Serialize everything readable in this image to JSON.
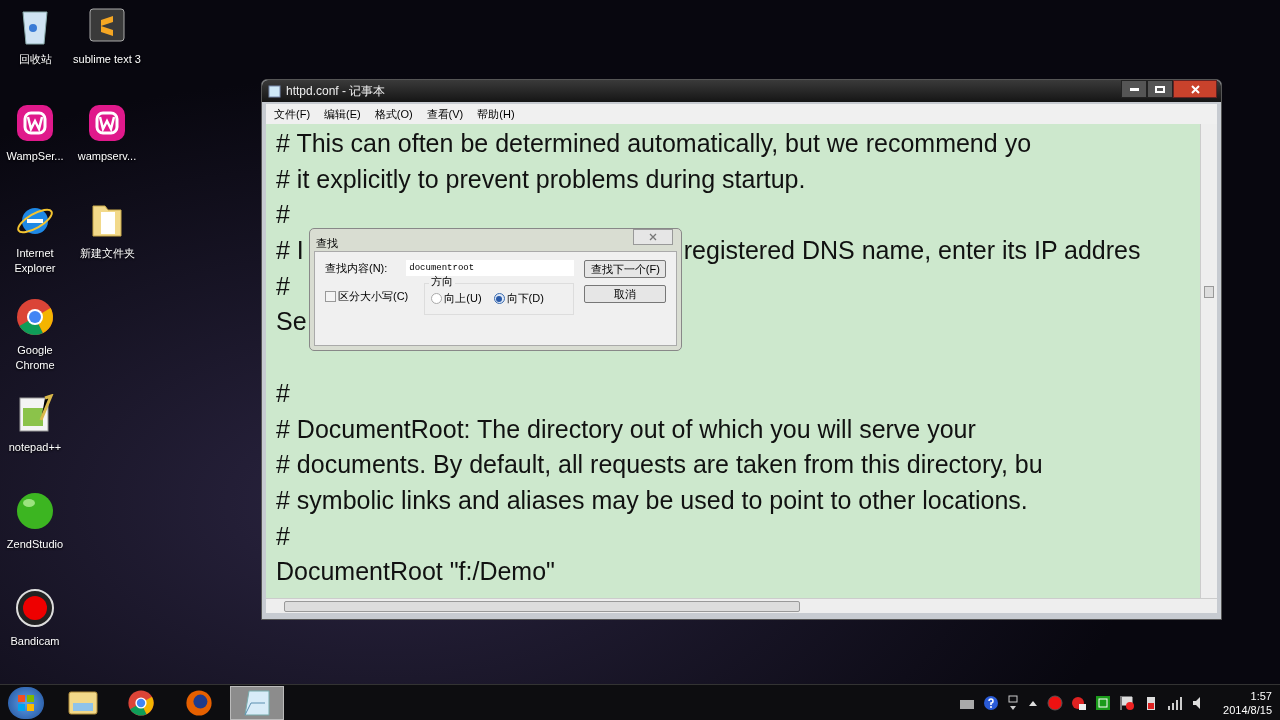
{
  "desktop_columns": [
    [
      {
        "label": "回收站",
        "kind": "recycle"
      },
      {
        "label": "WampSer...",
        "kind": "wamp"
      },
      {
        "label": "Internet Explorer",
        "kind": "ie"
      },
      {
        "label": "Google Chrome",
        "kind": "chrome"
      },
      {
        "label": "notepad++",
        "kind": "notepadpp"
      },
      {
        "label": "ZendStudio",
        "kind": "zend"
      },
      {
        "label": "Bandicam",
        "kind": "bandicam"
      }
    ],
    [
      {
        "label": "sublime text 3",
        "kind": "sublime"
      },
      {
        "label": "wampserv...",
        "kind": "wamp"
      },
      {
        "label": "新建文件夹",
        "kind": "folder"
      }
    ]
  ],
  "window": {
    "title": "httpd.conf - 记事本",
    "menu": [
      "文件(F)",
      "编辑(E)",
      "格式(O)",
      "查看(V)",
      "帮助(H)"
    ],
    "lines": [
      {
        "kind": "text",
        "text": "# This can often be determined automatically, but we recommend yo"
      },
      {
        "kind": "text",
        "text": "# it explicitly to prevent problems during startup."
      },
      {
        "kind": "text",
        "text": "#"
      },
      {
        "kind": "split",
        "left": "# I",
        "right": "registered DNS name, enter its IP addres"
      },
      {
        "kind": "text",
        "text": "#"
      },
      {
        "kind": "text",
        "text": "Se"
      },
      {
        "kind": "blank"
      },
      {
        "kind": "text",
        "text": "#"
      },
      {
        "kind": "text",
        "text": "# DocumentRoot: The directory out of which you will serve your"
      },
      {
        "kind": "text",
        "text": "# documents. By default, all requests are taken from this directory, bu"
      },
      {
        "kind": "text",
        "text": "# symbolic links and aliases may be used to point to other locations."
      },
      {
        "kind": "text",
        "text": "#"
      },
      {
        "kind": "text",
        "text": "DocumentRoot \"f:/Demo\""
      }
    ]
  },
  "find_dialog": {
    "title": "查找",
    "find_label": "查找内容(N):",
    "find_value": "documentroot",
    "find_next": "查找下一个(F)",
    "cancel": "取消",
    "match_case": {
      "label": "区分大小写(C)",
      "checked": false
    },
    "direction_label": "方向",
    "directions": [
      {
        "label": "向上(U)",
        "selected": false
      },
      {
        "label": "向下(D)",
        "selected": true
      }
    ]
  },
  "taskbar": {
    "apps": [
      {
        "kind": "explorer",
        "selected": false
      },
      {
        "kind": "chrome",
        "selected": false
      },
      {
        "kind": "firefox",
        "selected": false
      },
      {
        "kind": "notepad",
        "selected": true
      }
    ],
    "time": "1:57",
    "date": "2014/8/15"
  }
}
